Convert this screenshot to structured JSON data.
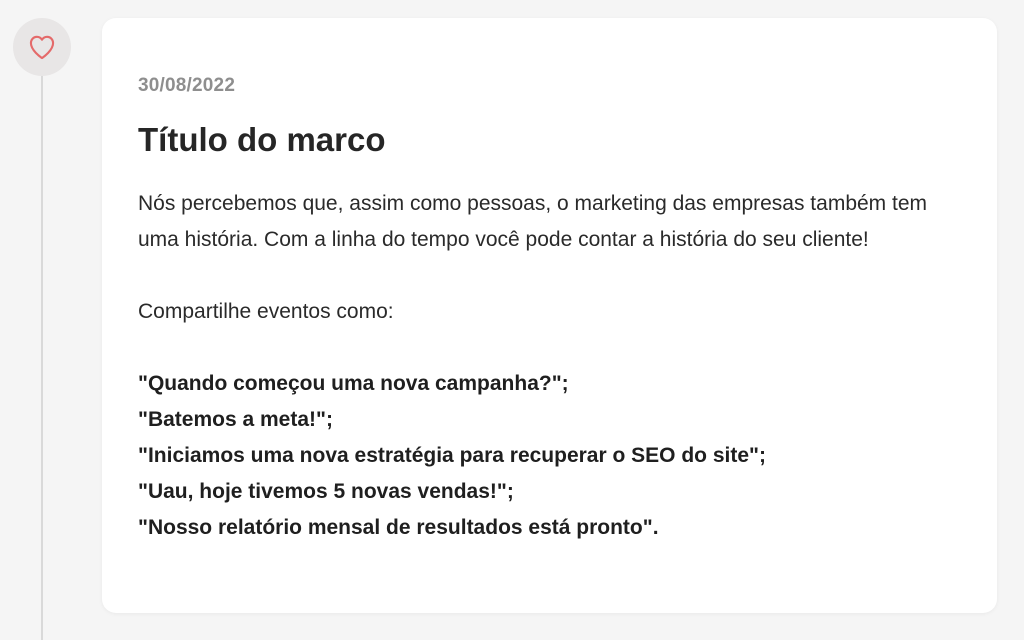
{
  "marker": {
    "icon": "heart-icon",
    "icon_color": "#e46a6a"
  },
  "milestone": {
    "date": "30/08/2022",
    "title": "Título do marco",
    "description": "Nós percebemos que, assim como pessoas, o marketing das empresas também tem uma história. Com a linha do tempo você pode contar a história do seu cliente!",
    "share_intro": "Compartilhe eventos como:",
    "events": [
      "\"Quando começou uma nova campanha?\";",
      "\"Batemos a meta!\";",
      "\"Iniciamos uma nova estratégia para recuperar o SEO do site\";",
      "\"Uau, hoje tivemos 5 novas vendas!\";",
      "\"Nosso relatório mensal de resultados está pronto\"."
    ]
  }
}
